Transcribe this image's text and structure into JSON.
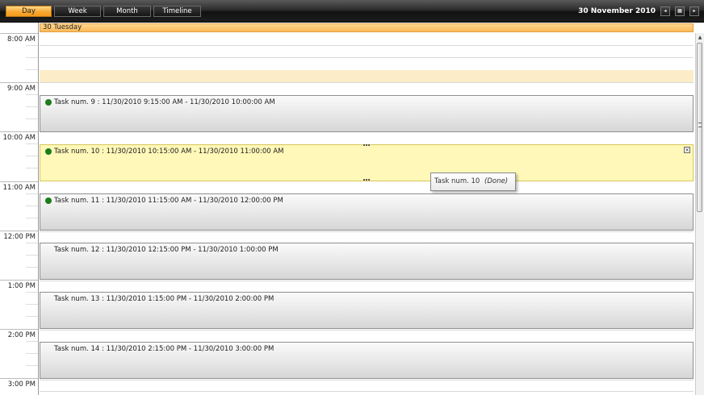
{
  "toolbar": {
    "views": [
      "Day",
      "Week",
      "Month",
      "Timeline"
    ],
    "active_view": "Day",
    "date": "30 November 2010",
    "prev_symbol": "◂",
    "today_symbol": "▦",
    "next_symbol": "▸"
  },
  "day_header": "30 Tuesday",
  "hours": [
    "8:00 AM",
    "9:00 AM",
    "10:00 AM",
    "11:00 AM",
    "12:00 PM",
    "1:00 PM",
    "2:00 PM",
    "3:00 PM"
  ],
  "appointments": [
    {
      "text": "Task num. 9 : 11/30/2010 9:15:00 AM - 11/30/2010 10:00:00 AM",
      "done": true,
      "selected": false
    },
    {
      "text": "Task num. 10 : 11/30/2010 10:15:00 AM - 11/30/2010 11:00:00 AM",
      "done": true,
      "selected": true
    },
    {
      "text": "Task num. 11 : 11/30/2010 11:15:00 AM - 11/30/2010 12:00:00 PM",
      "done": true,
      "selected": false
    },
    {
      "text": "Task num. 12 : 11/30/2010 12:15:00 PM - 11/30/2010 1:00:00 PM",
      "done": false,
      "selected": false
    },
    {
      "text": "Task num. 13 : 11/30/2010 1:15:00 PM - 11/30/2010 2:00:00 PM",
      "done": false,
      "selected": false
    },
    {
      "text": "Task num. 14 : 11/30/2010 2:15:00 PM - 11/30/2010 3:00:00 PM",
      "done": false,
      "selected": false
    }
  ],
  "tooltip": {
    "title": "Task num. 10",
    "status": "(Done)"
  },
  "close_symbol": "×",
  "scroll_up_symbol": "▲",
  "colors": {
    "accent": "#f7a833",
    "done_status": "#1b7d1b",
    "selected_bg": "#fff8b8"
  }
}
